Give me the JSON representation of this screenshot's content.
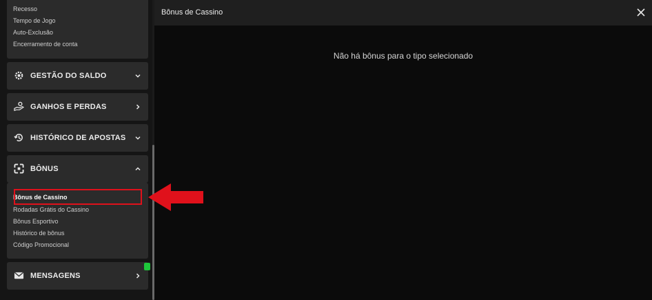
{
  "sidebar": {
    "top_submenu": [
      "Recesso",
      "Tempo de Jogo",
      "Auto-Exclusão",
      "Encerramento de conta"
    ],
    "menus": [
      {
        "label": "GESTÃO DO SALDO",
        "icon": "gear-icon",
        "chevron": "chevron-down-icon"
      },
      {
        "label": "GANHOS E PERDAS",
        "icon": "hand-coins-icon",
        "chevron": "chevron-right-icon"
      },
      {
        "label": "HISTÓRICO DE APOSTAS",
        "icon": "history-icon",
        "chevron": "chevron-down-icon"
      },
      {
        "label": "BÔNUS",
        "icon": "gift-icon",
        "chevron": "chevron-up-icon"
      },
      {
        "label": "MENSAGENS",
        "icon": "envelope-icon",
        "chevron": "chevron-right-icon"
      }
    ],
    "bonus_submenu": [
      "Bônus de Cassino",
      "Rodadas Grátis do Cassino",
      "Bônus Esportivo",
      "Histórico de bônus",
      "Código Promocional"
    ],
    "active_item": "Bônus de Cassino"
  },
  "panel": {
    "title": "Bônus de Cassino",
    "empty_message": "Não há bônus para o tipo selecionado"
  },
  "colors": {
    "highlight": "#e0111b",
    "badge": "#1ec73b",
    "row_bg": "#2b2b2b"
  }
}
